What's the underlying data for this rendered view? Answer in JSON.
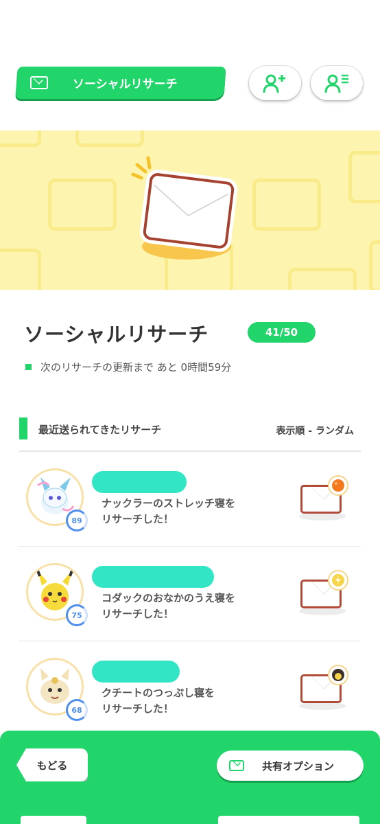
{
  "header": {
    "title_button_label": "ソーシャルリサーチ",
    "add_friend_icon": "add-friend-icon",
    "friend_list_icon": "friend-list-icon"
  },
  "banner": {
    "icon": "envelope-icon"
  },
  "main": {
    "title": "ソーシャルリサーチ",
    "count": "41/50",
    "update_text": "次のリサーチの更新まで あと 0時間59分"
  },
  "section": {
    "label": "最近送られてきたリサーチ",
    "sort": "表示順 - ランダム"
  },
  "research_list": [
    {
      "level": "89",
      "message_line1": "ナックラーのストレッチ寝を",
      "message_line2": "リサーチした！",
      "badge_color": "#f47a1f"
    },
    {
      "level": "75",
      "message_line1": "コダックのおなかのうえ寝を",
      "message_line2": "リサーチした！",
      "badge_color": "#f7d34a"
    },
    {
      "level": "68",
      "message_line1": "クチートのつっぷし寝を",
      "message_line2": "リサーチした！",
      "badge_color": "#3a2f2a"
    }
  ],
  "footer": {
    "back_label": "もどる",
    "share_label": "共有オプション"
  },
  "colors": {
    "accent": "#22d56b",
    "banner_bg": "#fdf4b0",
    "level_ring": "#4f8ff0"
  }
}
